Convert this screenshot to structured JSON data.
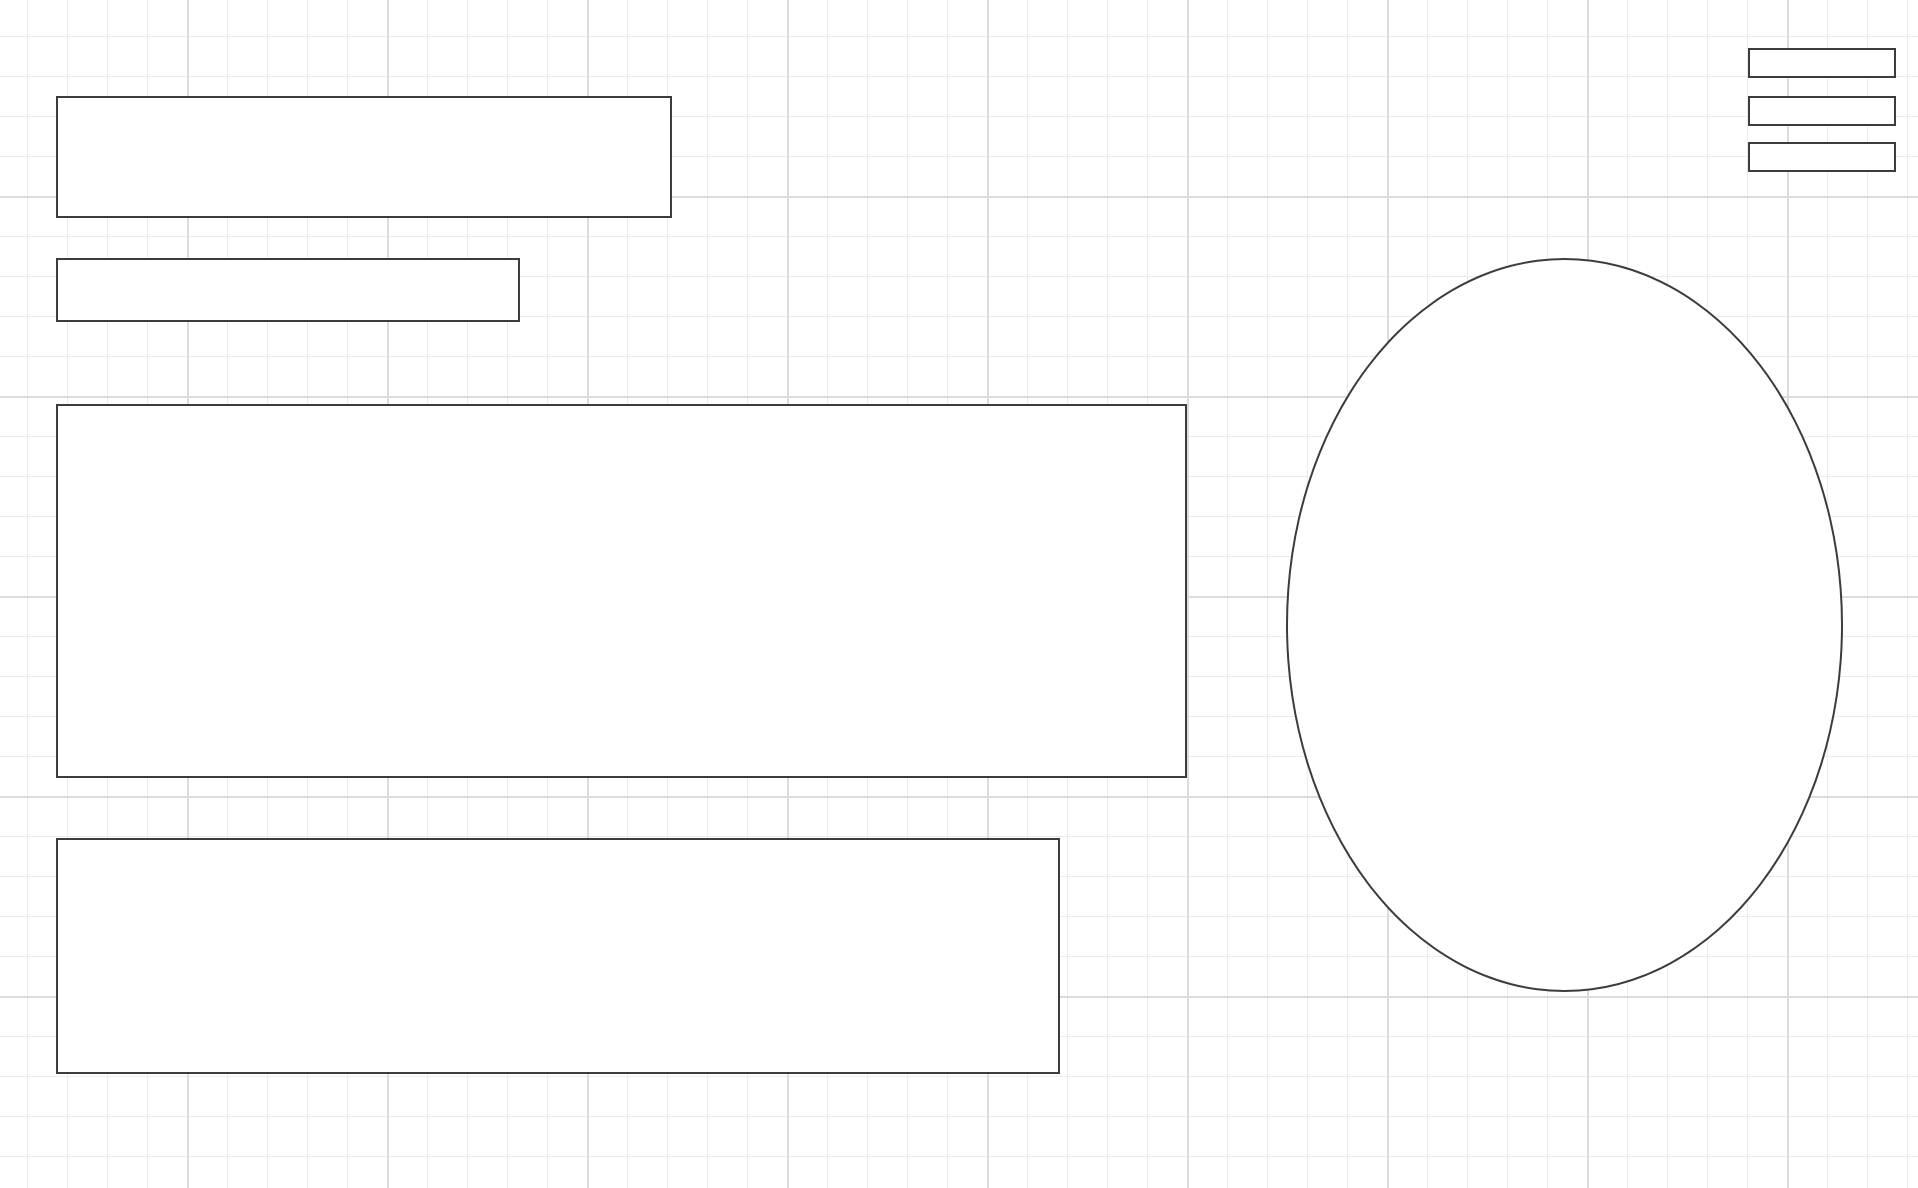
{
  "diagram": {
    "background": "grid",
    "colors": {
      "stroke": "#3c3c3c",
      "fill": "#ffffff",
      "grid_minor": "#ececec",
      "grid_major": "#dcdcdc"
    },
    "boxes": [
      {
        "label": ""
      },
      {
        "label": ""
      },
      {
        "label": ""
      },
      {
        "label": ""
      }
    ],
    "bars": [
      {
        "label": ""
      },
      {
        "label": ""
      },
      {
        "label": ""
      }
    ],
    "ellipse": {
      "label": ""
    }
  }
}
